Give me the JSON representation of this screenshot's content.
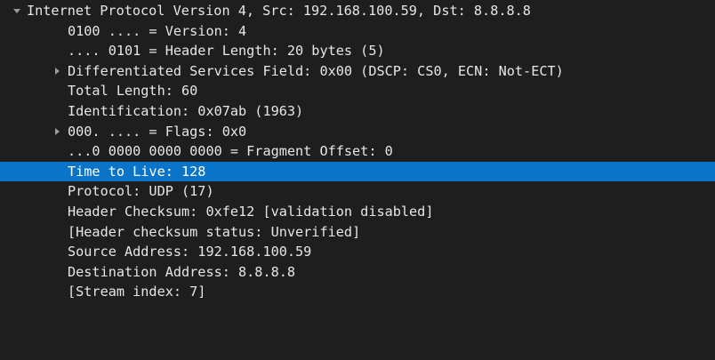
{
  "colors": {
    "background": "#1e1e1e",
    "text": "#e6e6e6",
    "selection": "#0a74c9",
    "expander": "#9a9a9a"
  },
  "tree": {
    "root": {
      "label": "Internet Protocol Version 4, Src: 192.168.100.59, Dst: 8.8.8.8",
      "expanded": true,
      "expander_icon": "triangle-down-icon"
    },
    "fields": [
      {
        "label": "0100 .... = Version: 4"
      },
      {
        "label": ".... 0101 = Header Length: 20 bytes (5)"
      },
      {
        "label": "Differentiated Services Field: 0x00 (DSCP: CS0, ECN: Not-ECT)",
        "expander_icon": "triangle-right-icon"
      },
      {
        "label": "Total Length: 60"
      },
      {
        "label": "Identification: 0x07ab (1963)"
      },
      {
        "label": "000. .... = Flags: 0x0",
        "expander_icon": "triangle-right-icon"
      },
      {
        "label": "...0 0000 0000 0000 = Fragment Offset: 0"
      },
      {
        "label": "Time to Live: 128",
        "selected": true
      },
      {
        "label": "Protocol: UDP (17)"
      },
      {
        "label": "Header Checksum: 0xfe12 [validation disabled]"
      },
      {
        "label": "[Header checksum status: Unverified]"
      },
      {
        "label": "Source Address: 192.168.100.59"
      },
      {
        "label": "Destination Address: 8.8.8.8"
      },
      {
        "label": "[Stream index: 7]"
      }
    ]
  }
}
